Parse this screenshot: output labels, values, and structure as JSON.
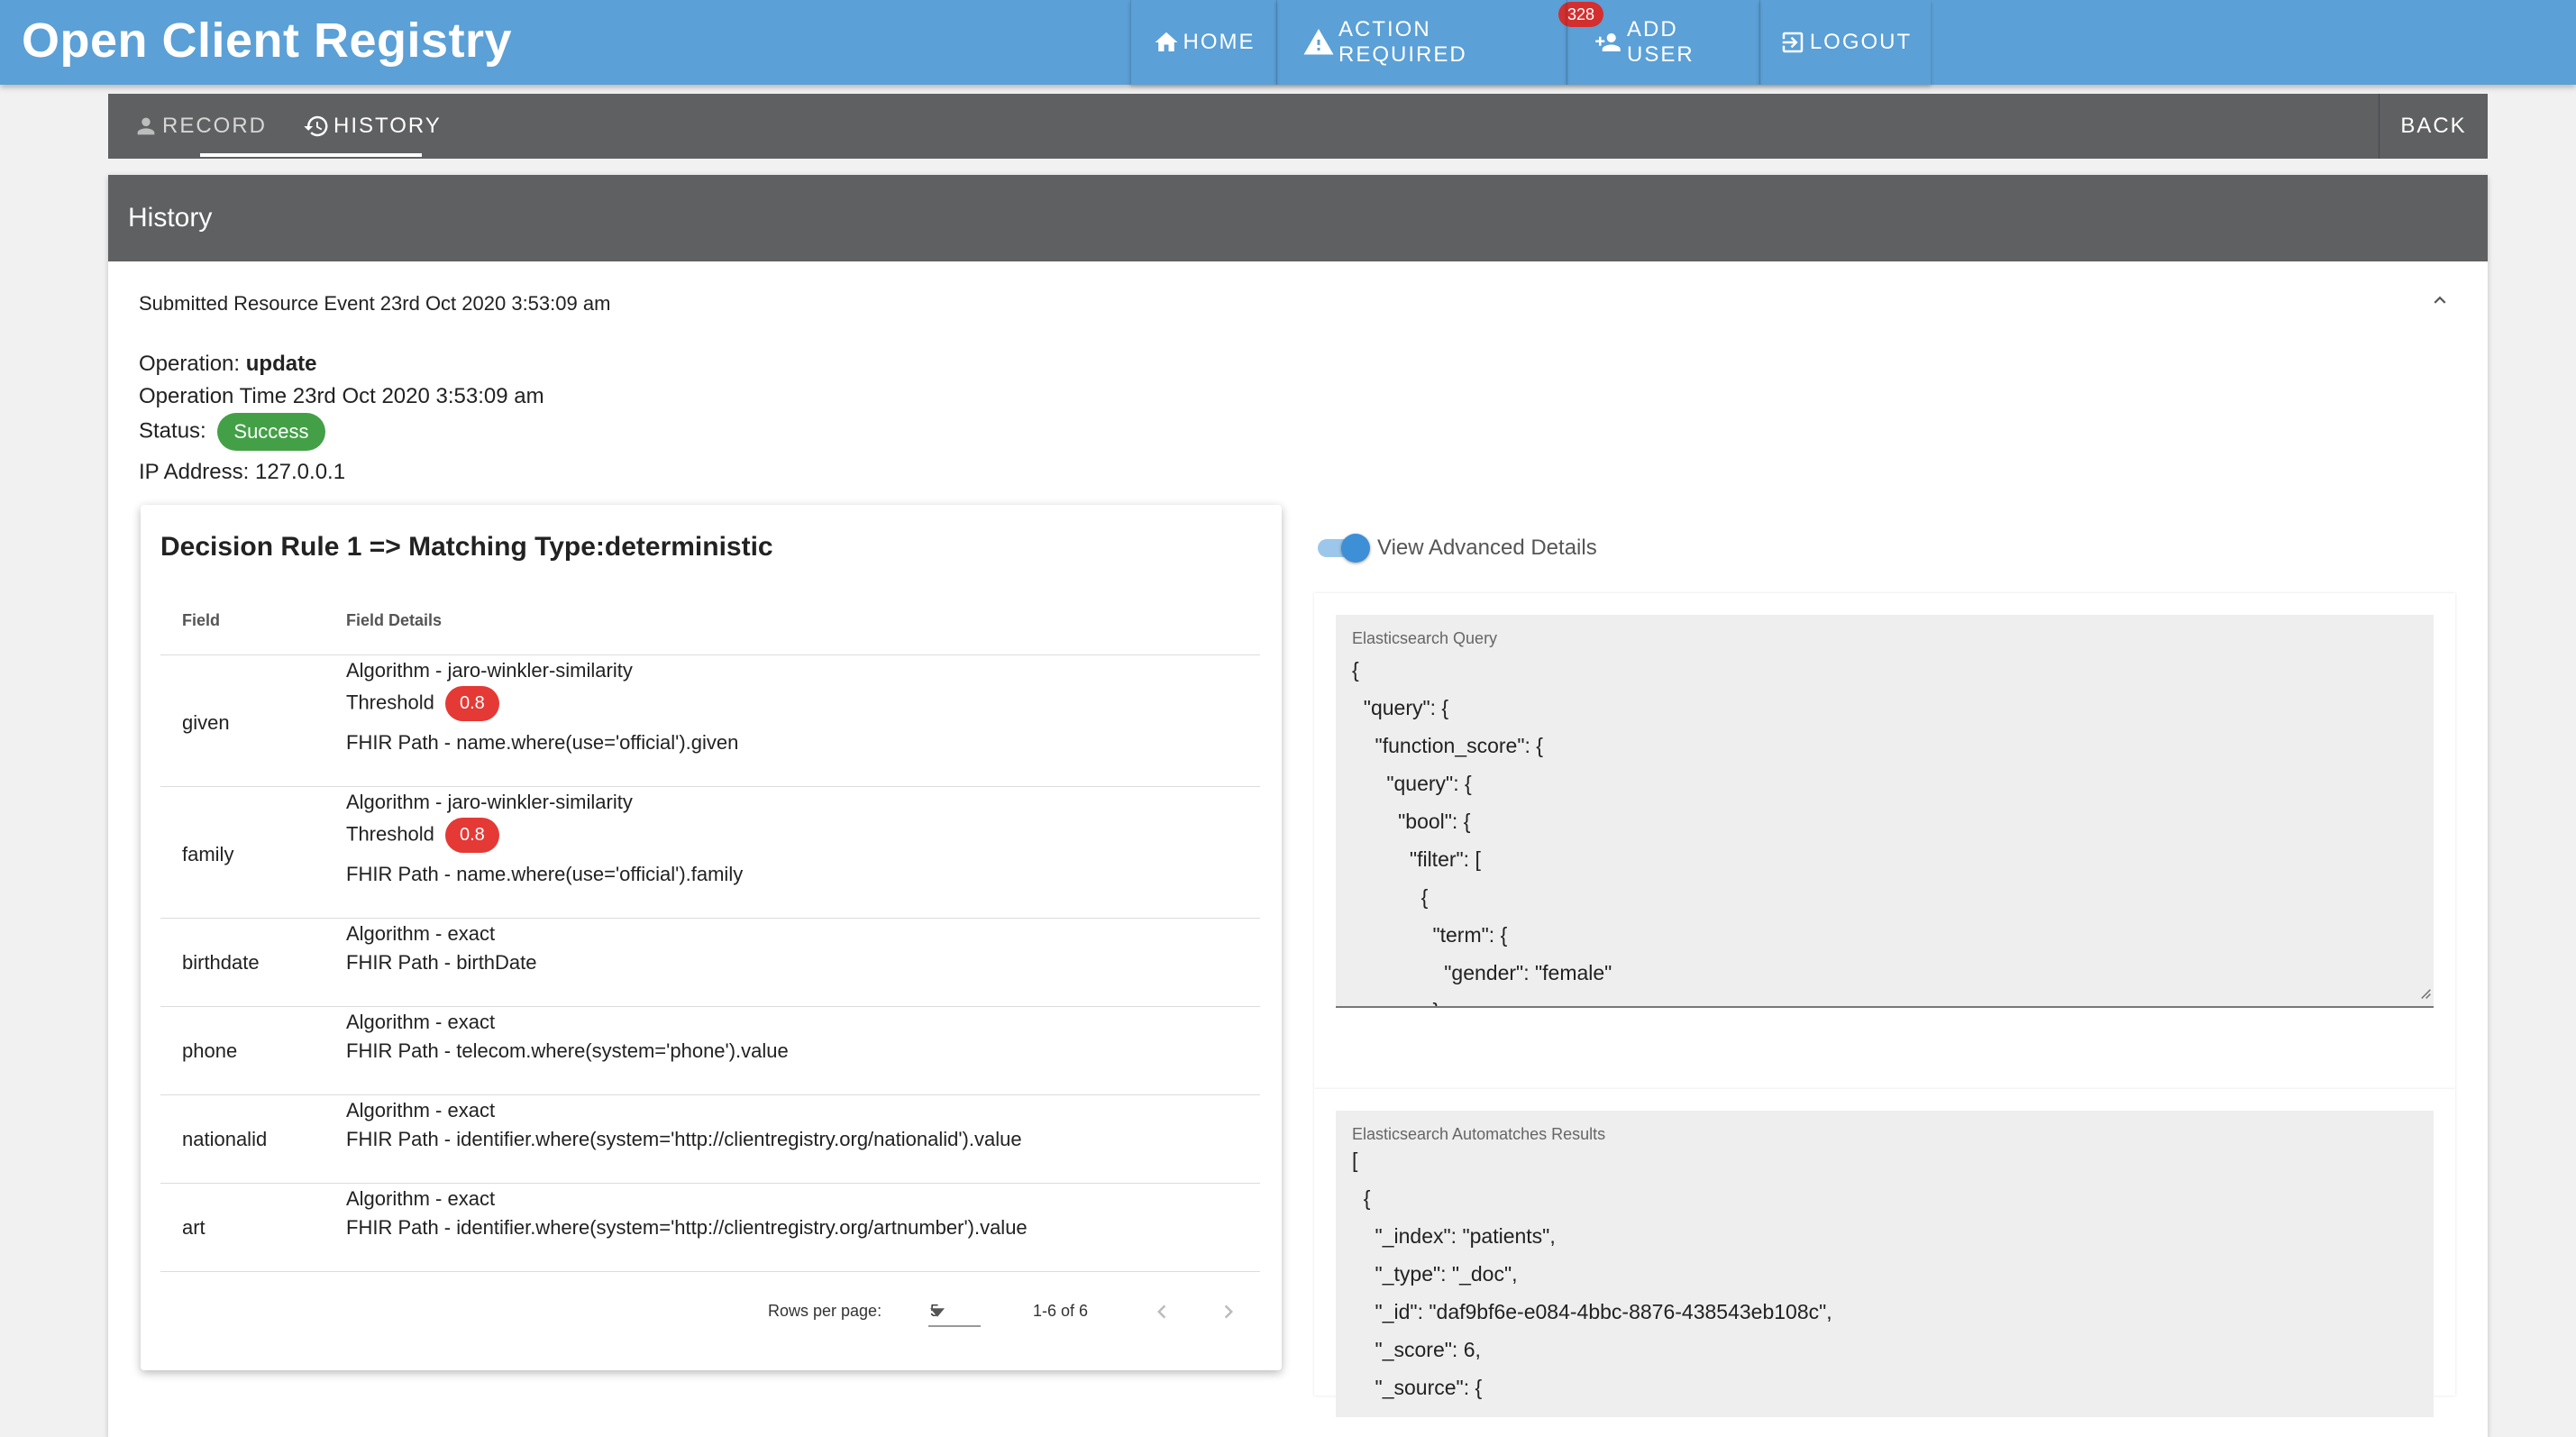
{
  "app": {
    "title": "Open Client Registry"
  },
  "nav": {
    "home": "HOME",
    "action_required": "ACTION REQUIRED",
    "action_count": "328",
    "add_user": "ADD USER",
    "logout": "LOGOUT"
  },
  "tabs": {
    "record": "RECORD",
    "history": "HISTORY",
    "back": "BACK"
  },
  "history": {
    "header": "History",
    "event_title": "Submitted Resource Event 23rd Oct 2020 3:53:09 am",
    "operation_label": "Operation:",
    "operation_value": "update",
    "operation_time": "Operation Time 23rd Oct 2020 3:53:09 am",
    "status_label": "Status:",
    "status_value": "Success",
    "ip_address": "IP Address: 127.0.0.1"
  },
  "rule": {
    "title": "Decision Rule 1 => Matching Type:deterministic",
    "col_field": "Field",
    "col_details": "Field Details",
    "rows": [
      {
        "field": "given",
        "algorithm": "Algorithm - jaro-winkler-similarity",
        "threshold_label": "Threshold",
        "threshold": "0.8",
        "path": "FHIR Path - name.where(use='official').given"
      },
      {
        "field": "family",
        "algorithm": "Algorithm - jaro-winkler-similarity",
        "threshold_label": "Threshold",
        "threshold": "0.8",
        "path": "FHIR Path - name.where(use='official').family"
      },
      {
        "field": "birthdate",
        "algorithm": "Algorithm - exact",
        "path": "FHIR Path - birthDate"
      },
      {
        "field": "phone",
        "algorithm": "Algorithm - exact",
        "path": "FHIR Path - telecom.where(system='phone').value"
      },
      {
        "field": "nationalid",
        "algorithm": "Algorithm - exact",
        "path": "FHIR Path - identifier.where(system='http://clientregistry.org/nationalid').value"
      },
      {
        "field": "art",
        "algorithm": "Algorithm - exact",
        "path": "FHIR Path - identifier.where(system='http://clientregistry.org/artnumber').value"
      }
    ],
    "rows_per_page_label": "Rows per page:",
    "rows_per_page": "5",
    "range": "1-6 of 6"
  },
  "advanced": {
    "label": "View Advanced Details",
    "query_label": "Elasticsearch Query",
    "query_lines": [
      "{",
      "  \"query\": {",
      "    \"function_score\": {",
      "      \"query\": {",
      "        \"bool\": {",
      "          \"filter\": [",
      "            {",
      "              \"term\": {",
      "                \"gender\": \"female\"",
      "              }"
    ],
    "results_label": "Elasticsearch Automatches Results",
    "results_lines": [
      "[",
      "  {",
      "    \"_index\": \"patients\",",
      "    \"_type\": \"_doc\",",
      "    \"_id\": \"daf9bf6e-e084-4bbc-8876-438543eb108c\",",
      "    \"_score\": 6,",
      "    \"_source\": {"
    ]
  }
}
